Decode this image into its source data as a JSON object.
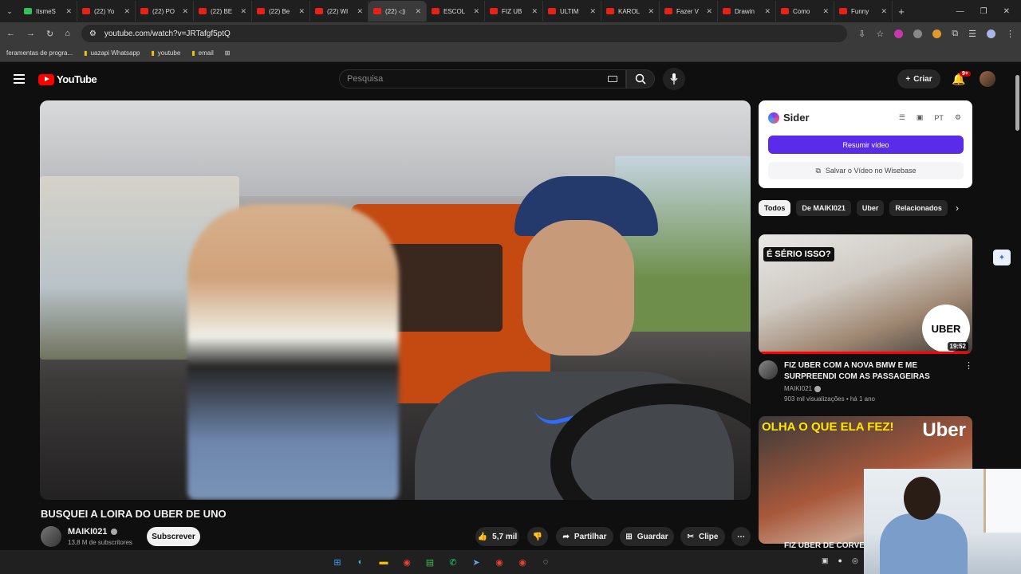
{
  "browser": {
    "tabs": [
      {
        "title": "ItsmeS",
        "icon": "green"
      },
      {
        "title": "(22) Yo",
        "icon": "youtube"
      },
      {
        "title": "(22) PO",
        "icon": "youtube"
      },
      {
        "title": "(22) BE",
        "icon": "youtube"
      },
      {
        "title": "(22) Be",
        "icon": "youtube"
      },
      {
        "title": "(22) WI",
        "icon": "youtube"
      },
      {
        "title": "(22) ◁)",
        "icon": "youtube",
        "active": true
      },
      {
        "title": "ESCOL",
        "icon": "youtube"
      },
      {
        "title": "FIZ UB",
        "icon": "youtube"
      },
      {
        "title": "ULTIM",
        "icon": "youtube"
      },
      {
        "title": "KAROL",
        "icon": "youtube"
      },
      {
        "title": "Fazer V",
        "icon": "youtube"
      },
      {
        "title": "Drawin",
        "icon": "youtube"
      },
      {
        "title": "Como",
        "icon": "youtube"
      },
      {
        "title": "Funny",
        "icon": "youtube"
      }
    ],
    "url": "youtube.com/watch?v=JRTafgf5ptQ",
    "bookmarks": [
      "feramentas de progra...",
      "uazapi Whatsapp",
      "youtube",
      "email"
    ]
  },
  "header": {
    "logo_text": "YouTube",
    "search_placeholder": "Pesquisa",
    "create_label": "Criar",
    "notif_badge": "9+"
  },
  "video": {
    "title": "BUSQUEI A LOIRA DO UBER DE UNO",
    "channel": "MAIKI021",
    "subscribers": "13,8 M de subscritores",
    "subscribe_label": "Subscrever",
    "likes": "5,7 mil",
    "share_label": "Partilhar",
    "save_label": "Guardar",
    "clip_label": "Clipe"
  },
  "sider": {
    "name": "Sider",
    "lang": "PT",
    "summarize_label": "Resumir vídeo",
    "save_label": "Salvar o Vídeo no Wisebase"
  },
  "chips": [
    "Todos",
    "De MAIKI021",
    "Uber",
    "Relacionados"
  ],
  "recommendations": [
    {
      "thumb_tag": "É SÉRIO ISSO?",
      "thumb_logo": "UBER",
      "duration": "19:52",
      "title": "FIZ UBER COM A NOVA BMW E ME SURPREENDI COM AS PASSAGEIRAS",
      "channel": "MAIKI021",
      "meta": "903 mil visualizações • há 1 ano",
      "watched_fraction": 1.0
    },
    {
      "thumb_text": "OLHA O QUE ELA FEZ!",
      "thumb_logo": "Uber",
      "title": "FIZ UBER DE CORVET"
    }
  ],
  "colors": {
    "accent_red": "#ff0000",
    "sider_purple": "#5a2be8",
    "background": "#0f0f0f"
  }
}
